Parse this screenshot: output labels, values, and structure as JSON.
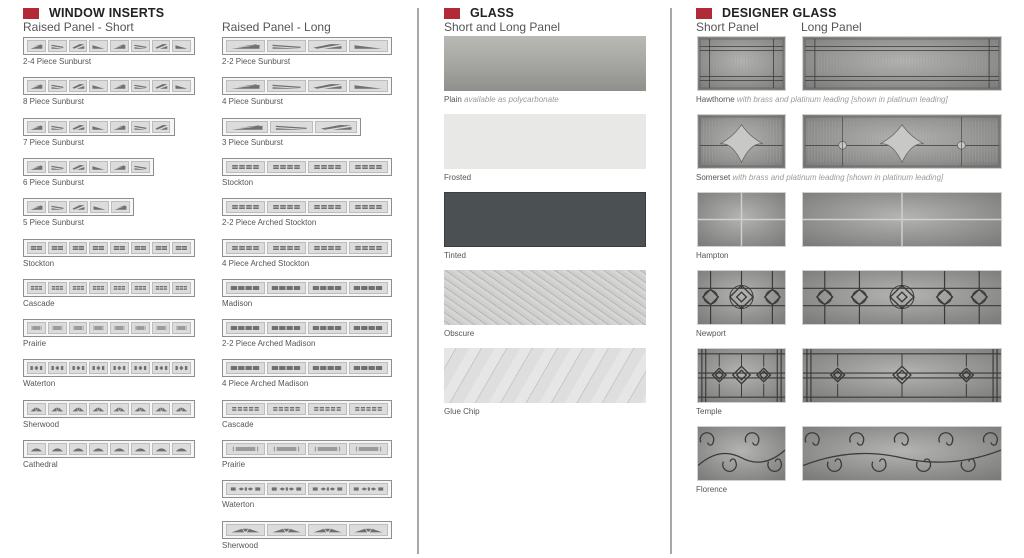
{
  "window_inserts": {
    "title": "WINDOW INSERTS",
    "accent_color": "#b22a35",
    "short": {
      "heading": "Raised Panel - Short",
      "items": [
        {
          "label": "2-4 Piece Sunburst",
          "panes": 8,
          "pattern": "sunburst"
        },
        {
          "label": "8 Piece Sunburst",
          "panes": 8,
          "pattern": "sunburst"
        },
        {
          "label": "7 Piece Sunburst",
          "panes": 7,
          "pattern": "sunburst"
        },
        {
          "label": "6 Piece Sunburst",
          "panes": 6,
          "pattern": "sunburst"
        },
        {
          "label": "5 Piece Sunburst",
          "panes": 5,
          "pattern": "sunburst"
        },
        {
          "label": "Stockton",
          "panes": 8,
          "pattern": "stockton"
        },
        {
          "label": "Cascade",
          "panes": 8,
          "pattern": "cascade"
        },
        {
          "label": "Prairie",
          "panes": 8,
          "pattern": "prairie"
        },
        {
          "label": "Waterton",
          "panes": 8,
          "pattern": "waterton"
        },
        {
          "label": "Sherwood",
          "panes": 8,
          "pattern": "sherwood"
        },
        {
          "label": "Cathedral",
          "panes": 8,
          "pattern": "cathedral"
        }
      ]
    },
    "long": {
      "heading": "Raised Panel - Long",
      "items": [
        {
          "label": "2-2 Piece Sunburst",
          "panes": 4,
          "pattern": "sunburst"
        },
        {
          "label": "4 Piece Sunburst",
          "panes": 4,
          "pattern": "sunburst"
        },
        {
          "label": "3 Piece Sunburst",
          "panes": 3,
          "pattern": "sunburst"
        },
        {
          "label": "Stockton",
          "panes": 4,
          "pattern": "stockton"
        },
        {
          "label": "2-2 Piece Arched Stockton",
          "panes": 4,
          "pattern": "stockton"
        },
        {
          "label": "4 Piece Arched Stockton",
          "panes": 4,
          "pattern": "stockton"
        },
        {
          "label": "Madison",
          "panes": 4,
          "pattern": "madison"
        },
        {
          "label": "2-2 Piece Arched Madison",
          "panes": 4,
          "pattern": "madison"
        },
        {
          "label": "4 Piece Arched Madison",
          "panes": 4,
          "pattern": "madison"
        },
        {
          "label": "Cascade",
          "panes": 4,
          "pattern": "cascade"
        },
        {
          "label": "Prairie",
          "panes": 4,
          "pattern": "prairie"
        },
        {
          "label": "Waterton",
          "panes": 4,
          "pattern": "waterton"
        },
        {
          "label": "Sherwood",
          "panes": 4,
          "pattern": "sherwood"
        }
      ]
    }
  },
  "glass": {
    "title": "GLASS",
    "heading": "Short and Long Panel",
    "items": [
      {
        "name": "Plain",
        "note": "available as polycarbonate",
        "color": "#a3a39f"
      },
      {
        "name": "Frosted",
        "note": "",
        "color": "#e8e9e7"
      },
      {
        "name": "Tinted",
        "note": "",
        "color": "#4b5052"
      },
      {
        "name": "Obscure",
        "note": "",
        "color": "#c9c9c7"
      },
      {
        "name": "Glue Chip",
        "note": "",
        "color": "#dadada"
      }
    ]
  },
  "designer_glass": {
    "title": "DESIGNER GLASS",
    "short_heading": "Short Panel",
    "long_heading": "Long Panel",
    "items": [
      {
        "name": "Hawthorne",
        "note": "with brass and platinum leading [shown in platinum leading]",
        "pattern": "hawthorne"
      },
      {
        "name": "Somerset",
        "note": "with brass and platinum leading [shown in platinum leading]",
        "pattern": "somerset"
      },
      {
        "name": "Hampton",
        "note": "",
        "pattern": "hampton"
      },
      {
        "name": "Newport",
        "note": "",
        "pattern": "newport"
      },
      {
        "name": "Temple",
        "note": "",
        "pattern": "temple"
      },
      {
        "name": "Florence",
        "note": "",
        "pattern": "florence"
      }
    ]
  }
}
